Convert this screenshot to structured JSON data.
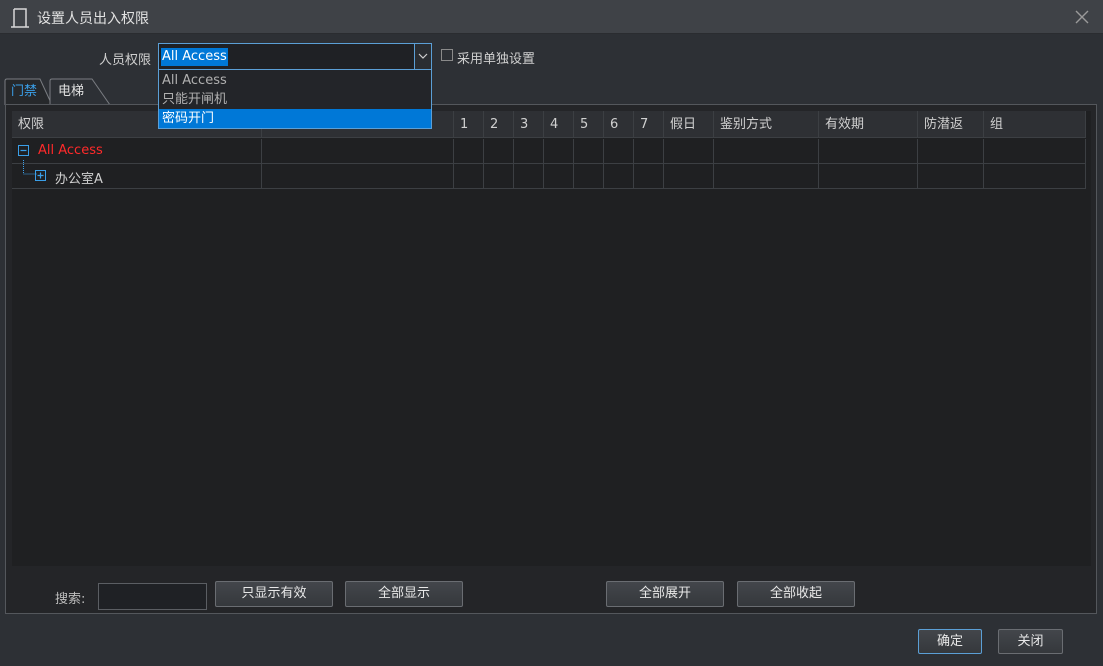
{
  "window": {
    "title": "设置人员出入权限"
  },
  "permission": {
    "label": "人员权限",
    "selected_value": "All Access",
    "options": [
      "All Access",
      "只能开闸机",
      "密码开门"
    ],
    "highlighted_index": 2
  },
  "individual_setting": {
    "label": "采用单独设置",
    "checked": false
  },
  "tabs": [
    {
      "label": "门禁",
      "active": true
    },
    {
      "label": "电梯",
      "active": false
    }
  ],
  "table": {
    "columns": [
      "权限",
      "",
      "1",
      "2",
      "3",
      "4",
      "5",
      "6",
      "7",
      "假日",
      "鉴别方式",
      "有效期",
      "防潜返",
      "组"
    ],
    "rows": [
      {
        "label": "All Access",
        "expanded": true,
        "level": 0
      },
      {
        "label": "办公室A",
        "expanded": false,
        "level": 1
      }
    ]
  },
  "toolbar": {
    "search_label": "搜索:",
    "search_value": "",
    "show_valid_label": "只显示有效",
    "show_all_label": "全部显示",
    "expand_all_label": "全部展开",
    "collapse_all_label": "全部收起"
  },
  "footer": {
    "ok_label": "确定",
    "close_label": "关闭"
  },
  "colors": {
    "accent": "#0078d7",
    "root_row": "#ff2a2a",
    "tab_active": "#3a9fe8"
  },
  "icons": {
    "app": "door-icon",
    "close": "close-icon",
    "expand": "plus-box-icon",
    "collapse": "minus-box-icon",
    "dropdown": "chevron-down-icon"
  }
}
